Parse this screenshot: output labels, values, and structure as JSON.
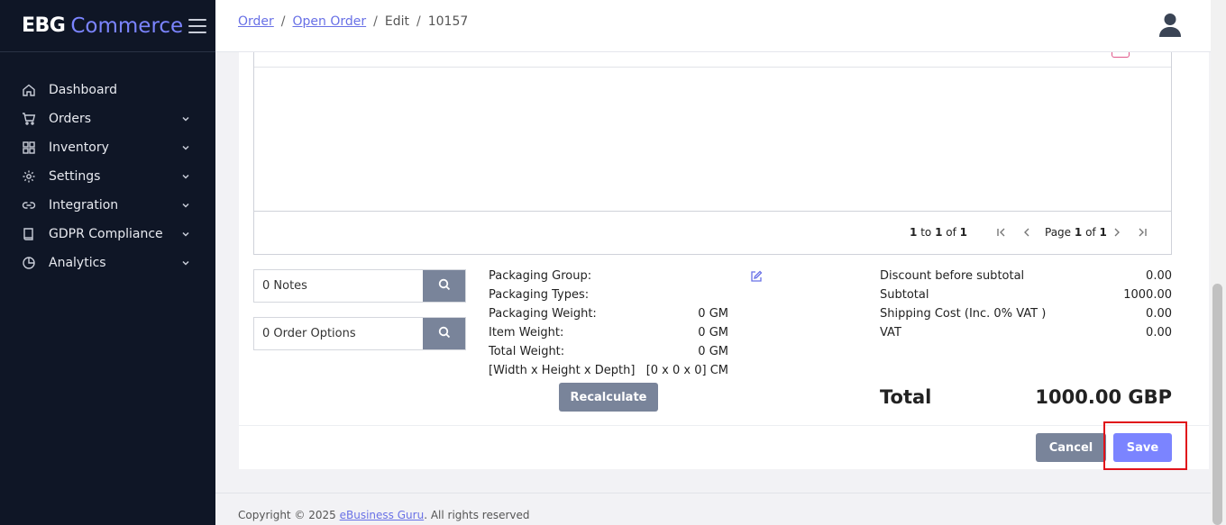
{
  "brand": {
    "ebg": "EBG",
    "commerce": "Commerce"
  },
  "sidebar": {
    "items": [
      {
        "label": "Dashboard",
        "icon": "home-icon",
        "expandable": false
      },
      {
        "label": "Orders",
        "icon": "cart-icon",
        "expandable": true
      },
      {
        "label": "Inventory",
        "icon": "grid-icon",
        "expandable": true
      },
      {
        "label": "Settings",
        "icon": "gear-icon",
        "expandable": true
      },
      {
        "label": "Integration",
        "icon": "link-icon",
        "expandable": true
      },
      {
        "label": "GDPR Compliance",
        "icon": "book-icon",
        "expandable": true
      },
      {
        "label": "Analytics",
        "icon": "pie-chart-icon",
        "expandable": true
      }
    ]
  },
  "breadcrumb": {
    "order": "Order",
    "open_order": "Open Order",
    "edit": "Edit",
    "id": "10157",
    "sep": "/"
  },
  "grid": {
    "count_from": "1",
    "count_to_label": "to",
    "count_to": "1",
    "count_of_label": "of",
    "count_total": "1",
    "page_label": "Page",
    "page_current": "1",
    "page_of_label": "of",
    "page_total": "1"
  },
  "notes": {
    "value": "0 Notes"
  },
  "order_options": {
    "value": "0 Order Options"
  },
  "packaging": {
    "group_label": "Packaging Group:",
    "types_label": "Packaging Types:",
    "weight_label": "Packaging Weight:",
    "weight_value": "0 GM",
    "item_weight_label": "Item Weight:",
    "item_weight_value": "0 GM",
    "total_weight_label": "Total Weight:",
    "total_weight_value": "0 GM",
    "dims_label": "[Width x Height x Depth]",
    "dims_value": "[0 x 0 x 0] CM",
    "recalculate": "Recalculate"
  },
  "totals": {
    "discount_label": "Discount before subtotal",
    "discount_value": "0.00",
    "subtotal_label": "Subtotal",
    "subtotal_value": "1000.00",
    "shipping_label": "Shipping Cost (Inc. 0% VAT )",
    "shipping_value": "0.00",
    "vat_label": "VAT",
    "vat_value": "0.00",
    "total_label": "Total",
    "total_value": "1000.00 GBP"
  },
  "actions": {
    "cancel": "Cancel",
    "save": "Save"
  },
  "footer": {
    "prefix": "Copyright © 2025 ",
    "link": "eBusiness Guru",
    "suffix": ". All rights reserved"
  },
  "colors": {
    "accent": "#7b84ff",
    "sidebar_bg": "#0f1626",
    "muted_button": "#79849a",
    "highlight": "#e0121a"
  }
}
